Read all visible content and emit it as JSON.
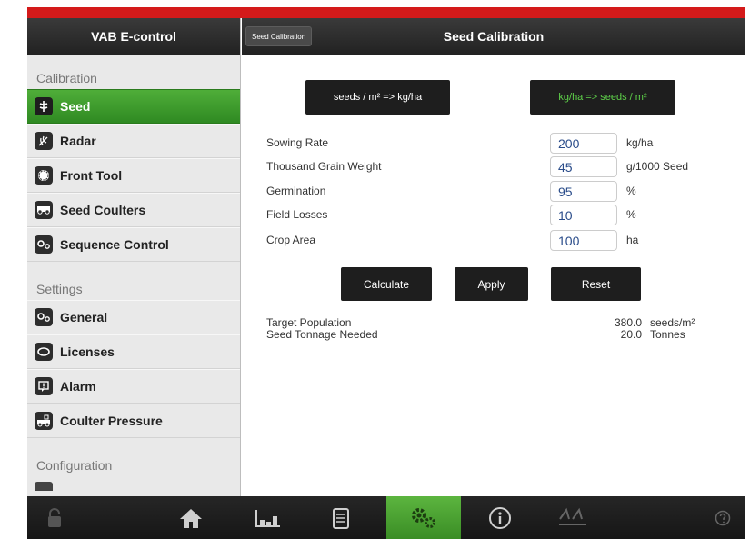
{
  "sidebar": {
    "title": "VAB E-control",
    "calibration_label": "Calibration",
    "settings_label": "Settings",
    "configuration_label": "Configuration",
    "calibration_items": [
      {
        "label": "Seed",
        "icon": "seed-icon"
      },
      {
        "label": "Radar",
        "icon": "radar-icon"
      },
      {
        "label": "Front Tool",
        "icon": "front-tool-icon"
      },
      {
        "label": "Seed Coulters",
        "icon": "seed-coulters-icon"
      },
      {
        "label": "Sequence Control",
        "icon": "sequence-control-icon"
      }
    ],
    "settings_items": [
      {
        "label": "General",
        "icon": "gears-icon"
      },
      {
        "label": "Licenses",
        "icon": "license-icon"
      },
      {
        "label": "Alarm",
        "icon": "alarm-icon"
      },
      {
        "label": "Coulter Pressure",
        "icon": "coulter-pressure-icon"
      }
    ]
  },
  "main": {
    "title": "Seed Calibration",
    "header_tab": "Seed Calibration",
    "mode_buttons": {
      "seeds_to_kg": "seeds / m² => kg/ha",
      "kg_to_seeds": "kg/ha => seeds / m²"
    },
    "fields": [
      {
        "label": "Sowing Rate",
        "value": "200",
        "unit": "kg/ha"
      },
      {
        "label": "Thousand Grain Weight",
        "value": "45",
        "unit": "g/1000 Seed"
      },
      {
        "label": "Germination",
        "value": "95",
        "unit": "%"
      },
      {
        "label": "Field Losses",
        "value": "10",
        "unit": "%"
      },
      {
        "label": "Crop Area",
        "value": "100",
        "unit": "ha"
      }
    ],
    "actions": {
      "calculate": "Calculate",
      "apply": "Apply",
      "reset": "Reset"
    },
    "results": [
      {
        "label": "Target Population",
        "value": "380.0",
        "unit": "seeds/m²"
      },
      {
        "label": "Seed Tonnage Needed",
        "value": "20.0",
        "unit": "Tonnes"
      }
    ]
  },
  "bottombar": {
    "tabs": [
      "lock-icon",
      "home-icon",
      "bar-chart-icon",
      "document-icon",
      "gears-icon",
      "info-icon",
      "seeder-icon",
      "help-icon"
    ],
    "active_tab": "gears-icon",
    "accent_color": "#3f9a2c"
  },
  "colors": {
    "top_accent": "#d41a1a",
    "active_green": "#3d9c2c",
    "header_dark": "#2a2a2a"
  }
}
